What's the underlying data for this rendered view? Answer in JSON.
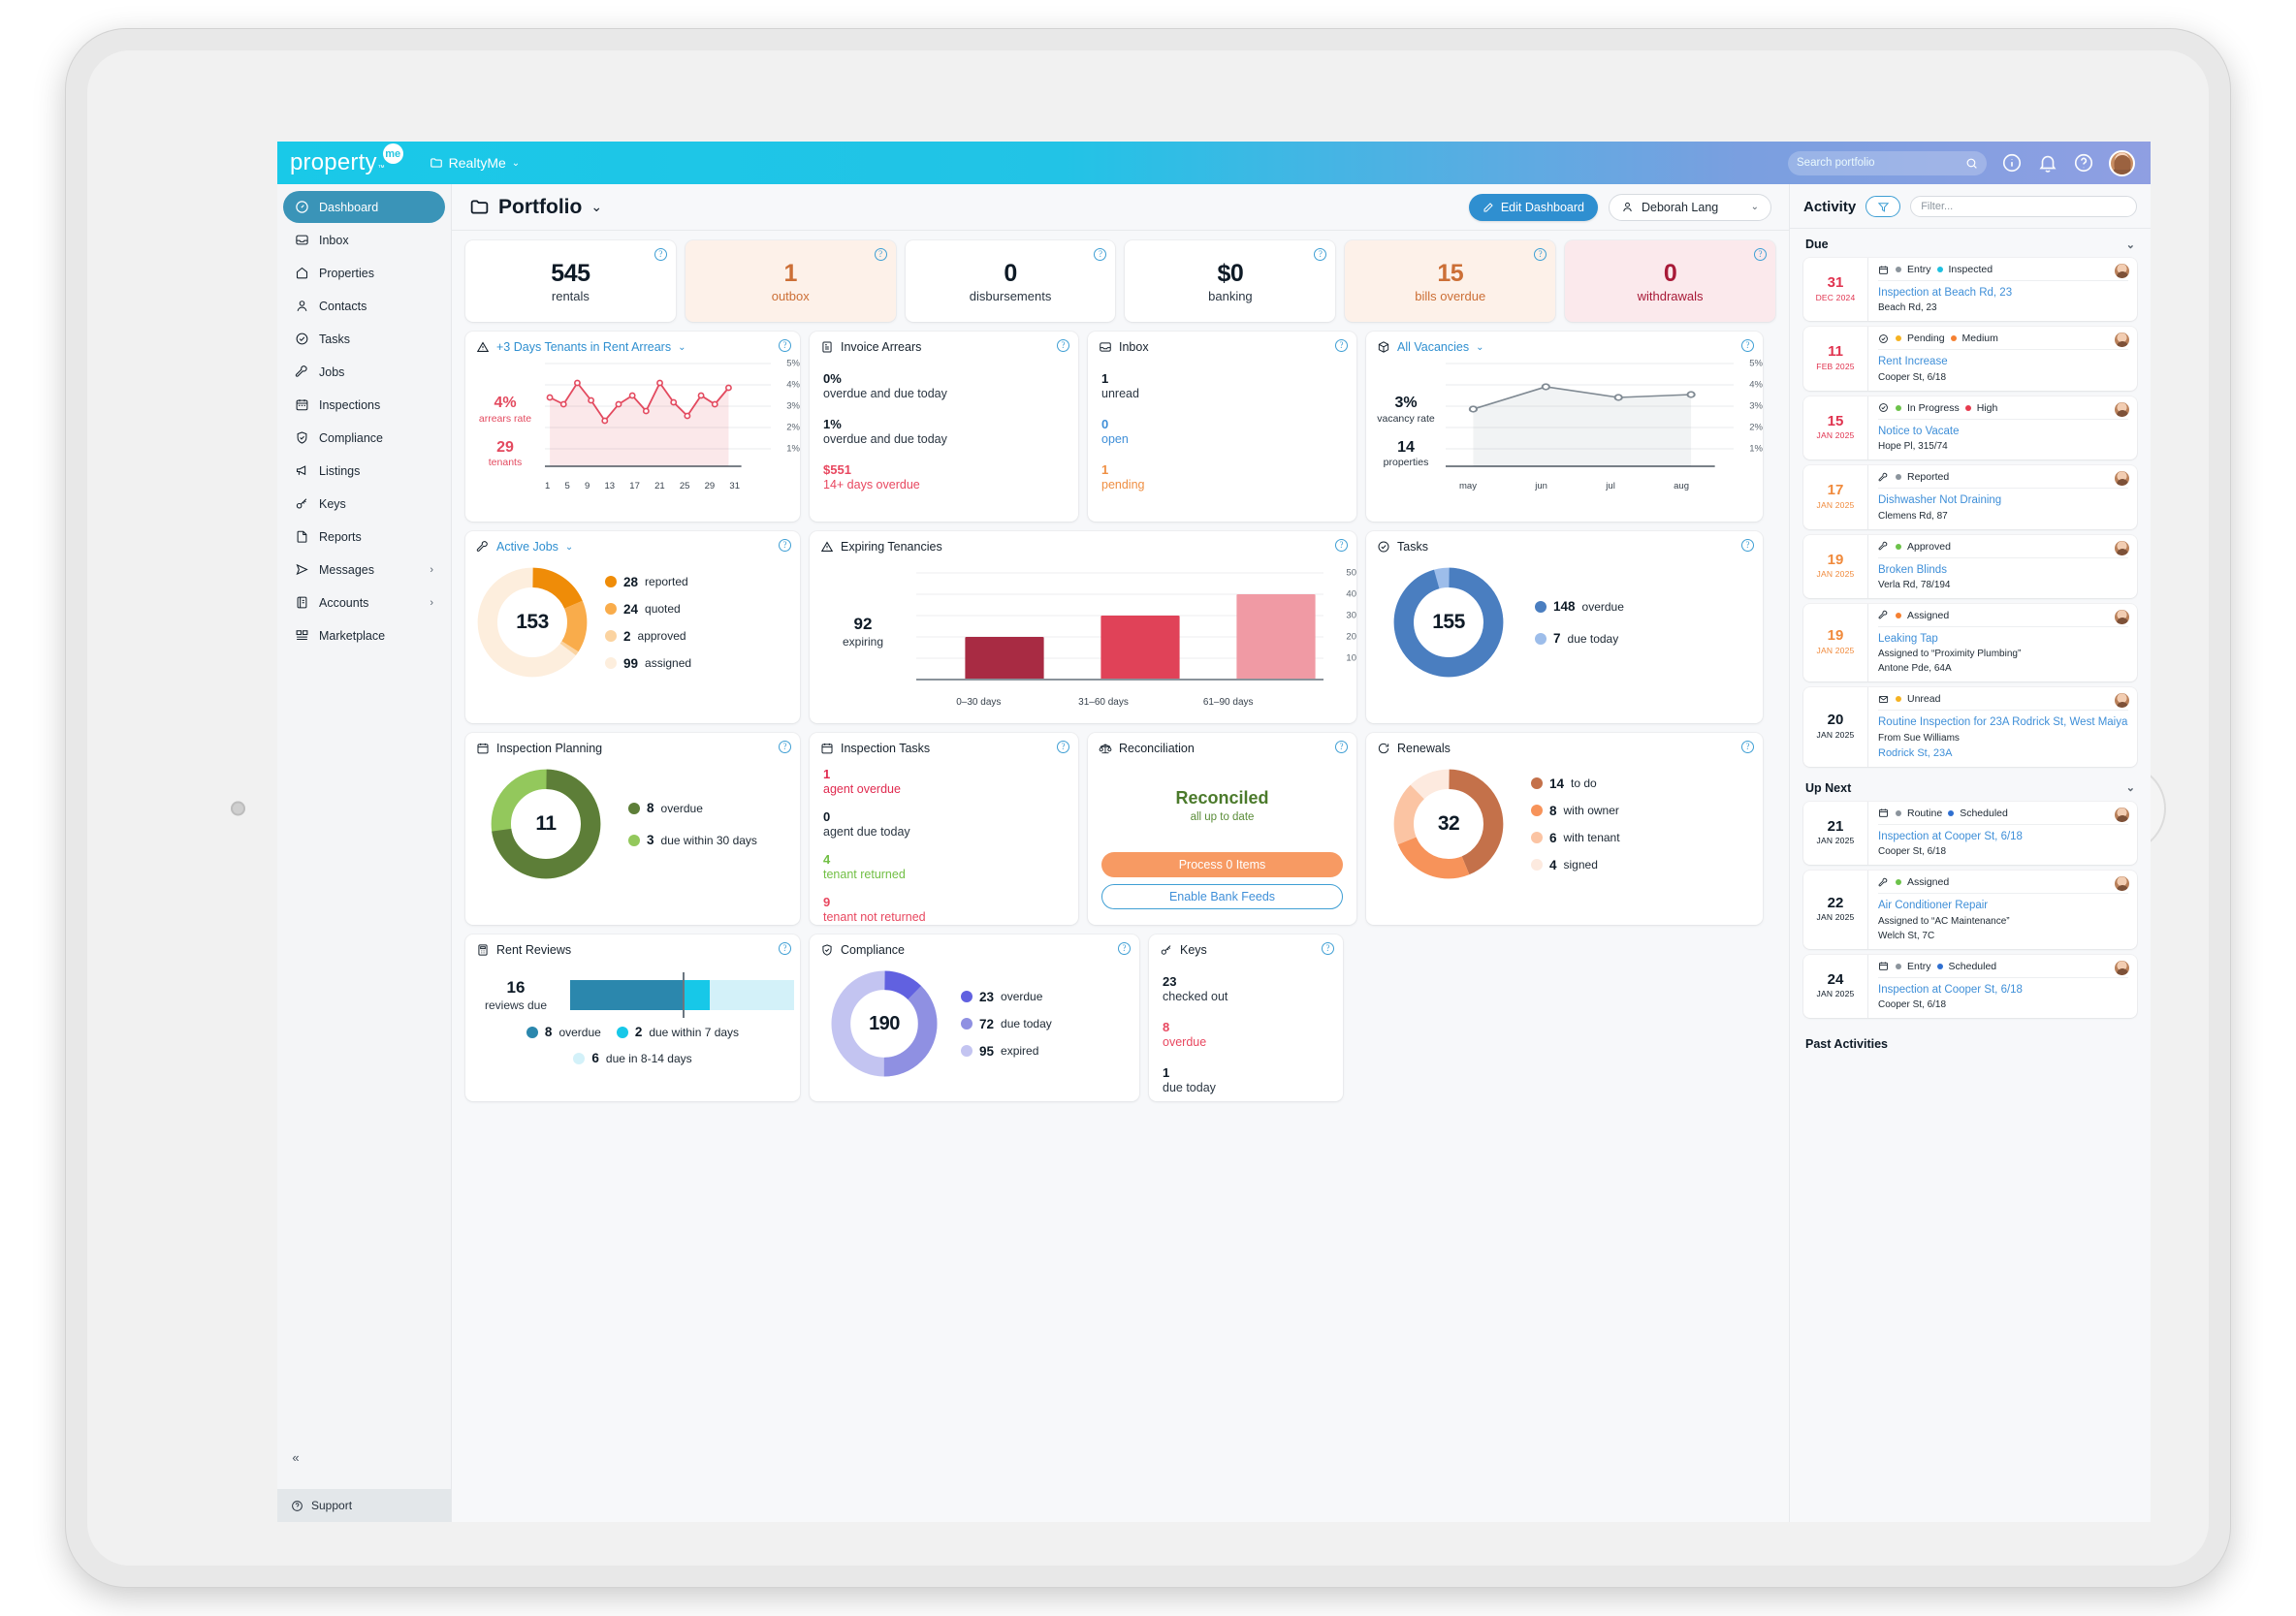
{
  "topbar": {
    "logo": "property",
    "logo_badge": "me",
    "logo_tm": "™",
    "org": "RealtyMe",
    "search_placeholder": "Search portfolio"
  },
  "sidebar": {
    "items": [
      {
        "label": "Dashboard",
        "icon": "gauge-icon",
        "active": true
      },
      {
        "label": "Inbox",
        "icon": "inbox-icon"
      },
      {
        "label": "Properties",
        "icon": "home-icon"
      },
      {
        "label": "Contacts",
        "icon": "person-icon"
      },
      {
        "label": "Tasks",
        "icon": "check-circle-icon"
      },
      {
        "label": "Jobs",
        "icon": "wrench-icon"
      },
      {
        "label": "Inspections",
        "icon": "calendar-icon"
      },
      {
        "label": "Compliance",
        "icon": "shield-check-icon"
      },
      {
        "label": "Listings",
        "icon": "megaphone-icon"
      },
      {
        "label": "Keys",
        "icon": "key-icon"
      },
      {
        "label": "Reports",
        "icon": "file-icon"
      },
      {
        "label": "Messages",
        "icon": "send-icon",
        "chevron": "›"
      },
      {
        "label": "Accounts",
        "icon": "ledger-icon",
        "chevron": "›"
      },
      {
        "label": "Marketplace",
        "icon": "grid-icon"
      }
    ],
    "collapse": "«",
    "support": "Support"
  },
  "header": {
    "title": "Portfolio",
    "title_chevron": "⌄",
    "edit_dashboard": "Edit Dashboard",
    "user": "Deborah Lang",
    "user_chevron": "⌄"
  },
  "kpis": [
    {
      "value": "545",
      "label": "rentals",
      "tone": "plain"
    },
    {
      "value": "1",
      "label": "outbox",
      "tone": "warn"
    },
    {
      "value": "0",
      "label": "disbursements",
      "tone": "plain"
    },
    {
      "value": "$0",
      "label": "banking",
      "tone": "plain"
    },
    {
      "value": "15",
      "label": "bills overdue",
      "tone": "warn"
    },
    {
      "value": "0",
      "label": "withdrawals",
      "tone": "danger"
    }
  ],
  "widgets": {
    "arrears": {
      "title": "+3 Days Tenants in Rent Arrears",
      "chevron": "⌄",
      "rate": "4%",
      "rate_label": "arrears rate",
      "count": "29",
      "count_label": "tenants"
    },
    "invoice_arrears": {
      "title": "Invoice Arrears",
      "stats": [
        {
          "value": "0%",
          "label": "overdue and due today",
          "tone": "plain"
        },
        {
          "value": "1%",
          "label": "overdue and due today",
          "tone": "plain"
        },
        {
          "value": "$551",
          "label": "14+ days overdue",
          "tone": "red"
        }
      ]
    },
    "inbox": {
      "title": "Inbox",
      "stats": [
        {
          "value": "1",
          "label": "unread",
          "tone": "plain"
        },
        {
          "value": "0",
          "label": "open",
          "tone": "blue"
        },
        {
          "value": "1",
          "label": "pending",
          "tone": "orange"
        }
      ]
    },
    "vacancies": {
      "title": "All Vacancies",
      "chevron": "⌄",
      "rate": "3%",
      "rate_label": "vacancy rate",
      "count": "14",
      "count_label": "properties"
    },
    "active_jobs": {
      "title": "Active Jobs",
      "chevron": "⌄",
      "total": "153",
      "legend": [
        {
          "value": "28",
          "label": "reported",
          "color": "#ef8c08"
        },
        {
          "value": "24",
          "label": "quoted",
          "color": "#f9ac4b"
        },
        {
          "value": "2",
          "label": "approved",
          "color": "#fbd3a0"
        },
        {
          "value": "99",
          "label": "assigned",
          "color": "#fdeedd"
        }
      ]
    },
    "expiring": {
      "title": "Expiring Tenancies",
      "total": "92",
      "total_label": "expiring"
    },
    "tasks": {
      "title": "Tasks",
      "total": "155",
      "legend": [
        {
          "value": "148",
          "label": "overdue",
          "color": "#4a7ec0"
        },
        {
          "value": "7",
          "label": "due today",
          "color": "#9dbdea"
        }
      ]
    },
    "inspection_planning": {
      "title": "Inspection Planning",
      "total": "11",
      "legend": [
        {
          "value": "8",
          "label": "overdue",
          "color": "#5d7e38"
        },
        {
          "value": "3",
          "label": "due within 30 days",
          "color": "#93c85c"
        }
      ]
    },
    "inspection_tasks": {
      "title": "Inspection Tasks",
      "stats": [
        {
          "value": "1",
          "label": "agent overdue",
          "tone": "crimson"
        },
        {
          "value": "0",
          "label": "agent due today",
          "tone": "plain"
        },
        {
          "value": "4",
          "label": "tenant returned",
          "tone": "green"
        },
        {
          "value": "9",
          "label": "tenant not returned",
          "tone": "red"
        }
      ]
    },
    "reconciliation": {
      "title": "Reconciliation",
      "status": "Reconciled",
      "status_sub": "all up to date",
      "primary_btn": "Process 0 Items",
      "secondary_btn": "Enable Bank Feeds"
    },
    "renewals": {
      "title": "Renewals",
      "total": "32",
      "legend": [
        {
          "value": "14",
          "label": "to do",
          "color": "#c4714a"
        },
        {
          "value": "8",
          "label": "with owner",
          "color": "#f7935a"
        },
        {
          "value": "6",
          "label": "with tenant",
          "color": "#fbc4a3"
        },
        {
          "value": "4",
          "label": "signed",
          "color": "#fdeadf"
        }
      ]
    },
    "rent_reviews": {
      "title": "Rent Reviews",
      "total": "16",
      "total_label": "reviews due",
      "legend": [
        {
          "value": "8",
          "label": "overdue",
          "color": "#2b87ad"
        },
        {
          "value": "2",
          "label": "due within 7 days",
          "color": "#17c8e8"
        },
        {
          "value": "6",
          "label": "due in 8-14 days",
          "color": "#d3f1f9"
        }
      ]
    },
    "compliance": {
      "title": "Compliance",
      "total": "190",
      "legend": [
        {
          "value": "23",
          "label": "overdue",
          "color": "#6161e0"
        },
        {
          "value": "72",
          "label": "due today",
          "color": "#8f90e2"
        },
        {
          "value": "95",
          "label": "expired",
          "color": "#c3c4f1"
        }
      ]
    },
    "keys": {
      "title": "Keys",
      "stats": [
        {
          "value": "23",
          "label": "checked out",
          "tone": "plain"
        },
        {
          "value": "8",
          "label": "overdue",
          "tone": "red"
        },
        {
          "value": "1",
          "label": "due today",
          "tone": "plain"
        }
      ]
    }
  },
  "chart_data": [
    {
      "type": "line",
      "title": "+3 Days Tenants in Rent Arrears",
      "xlabel": "",
      "ylabel": "",
      "ylim": [
        0,
        5.6
      ],
      "ytick_labels": [
        "1%",
        "2%",
        "3%",
        "4%",
        "5%"
      ],
      "yticks": [
        1,
        2,
        3,
        4,
        5
      ],
      "xtick_labels": [
        "1",
        "5",
        "9",
        "13",
        "17",
        "21",
        "25",
        "29",
        "31"
      ],
      "x": [
        1,
        2,
        3,
        4,
        5,
        6,
        7,
        8,
        9,
        10,
        11,
        12,
        13,
        14,
        15,
        16
      ],
      "values": [
        3.85,
        3.5,
        4.6,
        3.7,
        2.75,
        3.55,
        4.0,
        3.2,
        4.6,
        3.75,
        3.0,
        4.0,
        3.5,
        4.35
      ],
      "grid": true,
      "legend": "none",
      "color": "#e34a5f",
      "annotations": [
        "4% arrears rate",
        "29 tenants"
      ]
    },
    {
      "type": "line",
      "title": "All Vacancies",
      "xlabel": "",
      "ylabel": "",
      "ylim": [
        0,
        5.6
      ],
      "ytick_labels": [
        "1%",
        "2%",
        "3%",
        "4%",
        "5%"
      ],
      "yticks": [
        1,
        2,
        3,
        4,
        5
      ],
      "categories": [
        "may",
        "jun",
        "jul",
        "aug"
      ],
      "values": [
        2.9,
        3.85,
        3.35,
        3.45
      ],
      "grid": true,
      "legend": "none",
      "color": "#808a93",
      "annotations": [
        "3% vacancy rate",
        "14 properties"
      ]
    },
    {
      "type": "bar",
      "title": "Expiring Tenancies",
      "categories": [
        "0–30 days",
        "31–60 days",
        "61–90 days"
      ],
      "values": [
        21,
        31,
        41
      ],
      "ylim": [
        0,
        55
      ],
      "yticks": [
        10,
        20,
        30,
        40,
        50
      ],
      "ytick_labels": [
        "10",
        "20",
        "30",
        "40",
        "50"
      ],
      "colors": [
        "#a82b43",
        "#e04258",
        "#f09aa4"
      ],
      "grid": true,
      "legend": "none",
      "annotations": [
        "92 expiring"
      ]
    },
    {
      "type": "pie",
      "title": "Active Jobs",
      "labels": [
        "reported",
        "quoted",
        "approved",
        "assigned"
      ],
      "values": [
        28,
        24,
        2,
        99
      ],
      "colors": [
        "#ef8c08",
        "#f9ac4b",
        "#fbd3a0",
        "#fdeedd"
      ],
      "center": "153"
    },
    {
      "type": "pie",
      "title": "Tasks",
      "labels": [
        "overdue",
        "due today"
      ],
      "values": [
        148,
        7
      ],
      "colors": [
        "#4a7ec0",
        "#9dbdea"
      ],
      "center": "155"
    },
    {
      "type": "pie",
      "title": "Inspection Planning",
      "labels": [
        "overdue",
        "due within 30 days"
      ],
      "values": [
        8,
        3
      ],
      "colors": [
        "#5d7e38",
        "#93c85c"
      ],
      "center": "11"
    },
    {
      "type": "pie",
      "title": "Renewals",
      "labels": [
        "to do",
        "with owner",
        "with tenant",
        "signed"
      ],
      "values": [
        14,
        8,
        6,
        4
      ],
      "colors": [
        "#c4714a",
        "#f7935a",
        "#fbc4a3",
        "#fdeadf"
      ],
      "center": "32"
    },
    {
      "type": "pie",
      "title": "Compliance",
      "labels": [
        "overdue",
        "due today",
        "expired"
      ],
      "values": [
        23,
        72,
        95
      ],
      "colors": [
        "#6161e0",
        "#8f90e2",
        "#c3c4f1"
      ],
      "center": "190"
    },
    {
      "type": "bar",
      "title": "Rent Reviews",
      "categories": [
        "overdue",
        "due within 7 days",
        "due in 8-14 days"
      ],
      "values": [
        8,
        2,
        6
      ],
      "colors": [
        "#2b87ad",
        "#17c8e8",
        "#d3f1f9"
      ],
      "grid": false,
      "legend": "bottom",
      "annotations": [
        "16 reviews due"
      ]
    }
  ],
  "activity": {
    "title": "Activity",
    "filter_placeholder": "Filter...",
    "sections": [
      {
        "label": "Due",
        "chevron": "⌄",
        "items": [
          {
            "day": "31",
            "month": "DEC 2024",
            "date_tone": "red",
            "icon": "calendar-icon",
            "tags": [
              {
                "text": "Entry",
                "color": "#8b949c"
              },
              {
                "text": "Inspected",
                "color": "#1ec0e0"
              }
            ],
            "title": "Inspection at Beach Rd, 23",
            "sub1": "Beach Rd, 23",
            "sub2": ""
          },
          {
            "day": "11",
            "month": "FEB 2025",
            "date_tone": "red",
            "icon": "check-circle-icon",
            "tags": [
              {
                "text": "Pending",
                "color": "#f5b221"
              },
              {
                "text": "Medium",
                "color": "#f58032"
              }
            ],
            "title": "Rent Increase",
            "sub1": "Cooper St, 6/18",
            "sub2": ""
          },
          {
            "day": "15",
            "month": "JAN 2025",
            "date_tone": "red",
            "icon": "check-circle-icon",
            "tags": [
              {
                "text": "In Progress",
                "color": "#6cc24a"
              },
              {
                "text": "High",
                "color": "#e63b4e"
              }
            ],
            "title": "Notice to Vacate",
            "sub1": "Hope Pl, 315/74",
            "sub2": ""
          },
          {
            "day": "17",
            "month": "JAN 2025",
            "date_tone": "orange",
            "icon": "wrench-icon",
            "tags": [
              {
                "text": "Reported",
                "color": "#8b949c"
              }
            ],
            "title": "Dishwasher Not Draining",
            "sub1": "Clemens Rd, 87",
            "sub2": ""
          },
          {
            "day": "19",
            "month": "JAN 2025",
            "date_tone": "orange",
            "icon": "wrench-icon",
            "tags": [
              {
                "text": "Approved",
                "color": "#6cc24a"
              }
            ],
            "title": "Broken Blinds",
            "sub1": "Verla Rd, 78/194",
            "sub2": ""
          },
          {
            "day": "19",
            "month": "JAN 2025",
            "date_tone": "orange",
            "icon": "wrench-icon",
            "tags": [
              {
                "text": "Assigned",
                "color": "#f58032"
              }
            ],
            "title": "Leaking Tap",
            "sub1": "Assigned to “Proximity Plumbing”",
            "sub2": "Antone Pde, 64A"
          },
          {
            "day": "20",
            "month": "JAN 2025",
            "date_tone": "dark",
            "icon": "envelope-icon",
            "tags": [
              {
                "text": "Unread",
                "color": "#f5b221"
              }
            ],
            "title": "Routine Inspection for 23A Rodrick St, West Maiya",
            "sub1": "From Sue Williams",
            "sub2": "Rodrick St, 23A",
            "sub2_link": true
          }
        ]
      },
      {
        "label": "Up Next",
        "chevron": "⌄",
        "items": [
          {
            "day": "21",
            "month": "JAN 2025",
            "date_tone": "dark",
            "icon": "calendar-icon",
            "tags": [
              {
                "text": "Routine",
                "color": "#8b949c"
              },
              {
                "text": "Scheduled",
                "color": "#2f6fd0"
              }
            ],
            "title": "Inspection at Cooper St, 6/18",
            "sub1": "Cooper St, 6/18",
            "sub2": ""
          },
          {
            "day": "22",
            "month": "JAN 2025",
            "date_tone": "dark",
            "icon": "wrench-icon",
            "tags": [
              {
                "text": "Assigned",
                "color": "#6cc24a"
              }
            ],
            "title": "Air Conditioner Repair",
            "sub1": "Assigned to “AC Maintenance”",
            "sub2": "Welch St, 7C"
          },
          {
            "day": "24",
            "month": "JAN 2025",
            "date_tone": "dark",
            "icon": "calendar-icon",
            "tags": [
              {
                "text": "Entry",
                "color": "#8b949c"
              },
              {
                "text": "Scheduled",
                "color": "#2f6fd0"
              }
            ],
            "title": "Inspection at Cooper St, 6/18",
            "sub1": "Cooper St, 6/18",
            "sub2": ""
          }
        ]
      }
    ],
    "past_label": "Past Activities"
  }
}
